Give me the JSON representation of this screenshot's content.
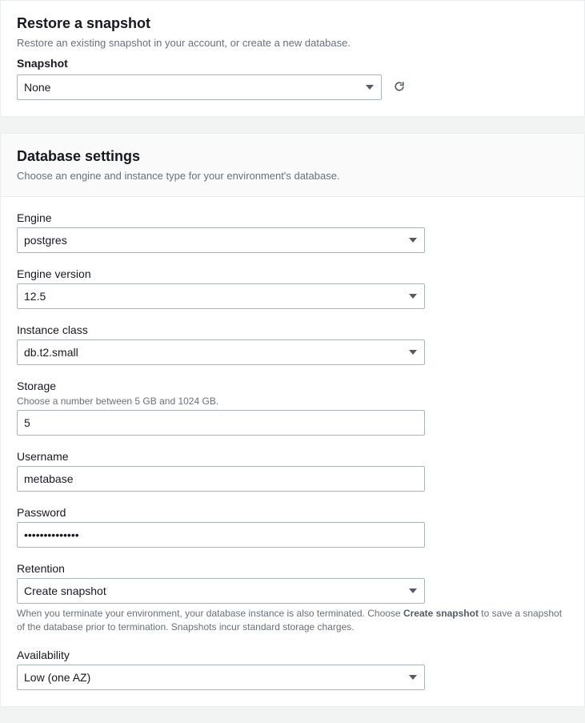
{
  "snapshot_section": {
    "title": "Restore a snapshot",
    "description": "Restore an existing snapshot in your account, or create a new database.",
    "label": "Snapshot",
    "value": "None"
  },
  "db_settings": {
    "title": "Database settings",
    "description": "Choose an engine and instance type for your environment's database.",
    "engine": {
      "label": "Engine",
      "value": "postgres"
    },
    "engine_version": {
      "label": "Engine version",
      "value": "12.5"
    },
    "instance_class": {
      "label": "Instance class",
      "value": "db.t2.small"
    },
    "storage": {
      "label": "Storage",
      "hint": "Choose a number between 5 GB and 1024 GB.",
      "value": "5"
    },
    "username": {
      "label": "Username",
      "value": "metabase"
    },
    "password": {
      "label": "Password",
      "value": "••••••••••••••"
    },
    "retention": {
      "label": "Retention",
      "value": "Create snapshot",
      "hint_prefix": "When you terminate your environment, your database instance is also terminated. Choose ",
      "hint_strong": "Create snapshot",
      "hint_suffix": " to save a snapshot of the database prior to termination. Snapshots incur standard storage charges."
    },
    "availability": {
      "label": "Availability",
      "value": "Low (one AZ)"
    }
  }
}
